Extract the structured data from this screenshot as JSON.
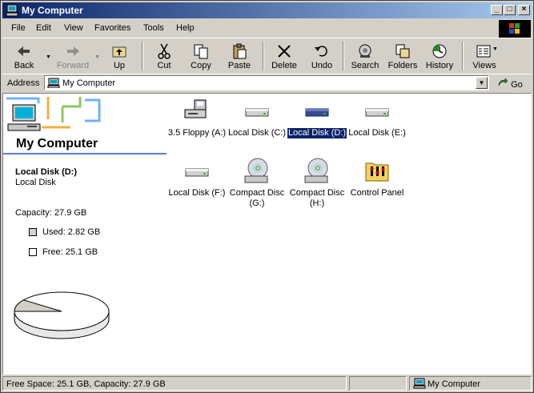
{
  "window": {
    "title": "My Computer",
    "app_icon": "my-computer-icon"
  },
  "menu": [
    "File",
    "Edit",
    "View",
    "Favorites",
    "Tools",
    "Help"
  ],
  "toolbar": {
    "back": "Back",
    "forward": "Forward",
    "up": "Up",
    "cut": "Cut",
    "copy": "Copy",
    "paste": "Paste",
    "delete": "Delete",
    "undo": "Undo",
    "search": "Search",
    "folders": "Folders",
    "history": "History",
    "views": "Views"
  },
  "address": {
    "label": "Address",
    "value": "My Computer",
    "go": "Go"
  },
  "left_pane": {
    "title": "My Computer",
    "selected_name": "Local Disk (D:)",
    "selected_type": "Local Disk",
    "capacity": "Capacity: 27.9 GB",
    "used": "Used: 2.82 GB",
    "free": "Free: 25.1 GB",
    "used_fraction": 0.101,
    "used_color": "#d4d0c8",
    "free_color": "#ffffff"
  },
  "items": [
    {
      "label": "3.5 Floppy (A:)",
      "icon": "floppy-drive-icon"
    },
    {
      "label": "Local Disk (C:)",
      "icon": "hard-disk-icon"
    },
    {
      "label": "Local Disk (D:)",
      "icon": "hard-disk-icon",
      "selected": true
    },
    {
      "label": "Local Disk (E:)",
      "icon": "hard-disk-icon"
    },
    {
      "label": "Local Disk (F:)",
      "icon": "hard-disk-icon"
    },
    {
      "label": "Compact Disc (G:)",
      "icon": "cd-drive-icon"
    },
    {
      "label": "Compact Disc (H:)",
      "icon": "cd-drive-icon"
    },
    {
      "label": "Control Panel",
      "icon": "control-panel-icon"
    }
  ],
  "status": {
    "info": "Free Space: 25.1 GB, Capacity: 27.9 GB",
    "zone": "My Computer"
  },
  "colors": {
    "selection": "#0a246a",
    "title_start": "#0a246a",
    "title_end": "#a6caf0"
  }
}
